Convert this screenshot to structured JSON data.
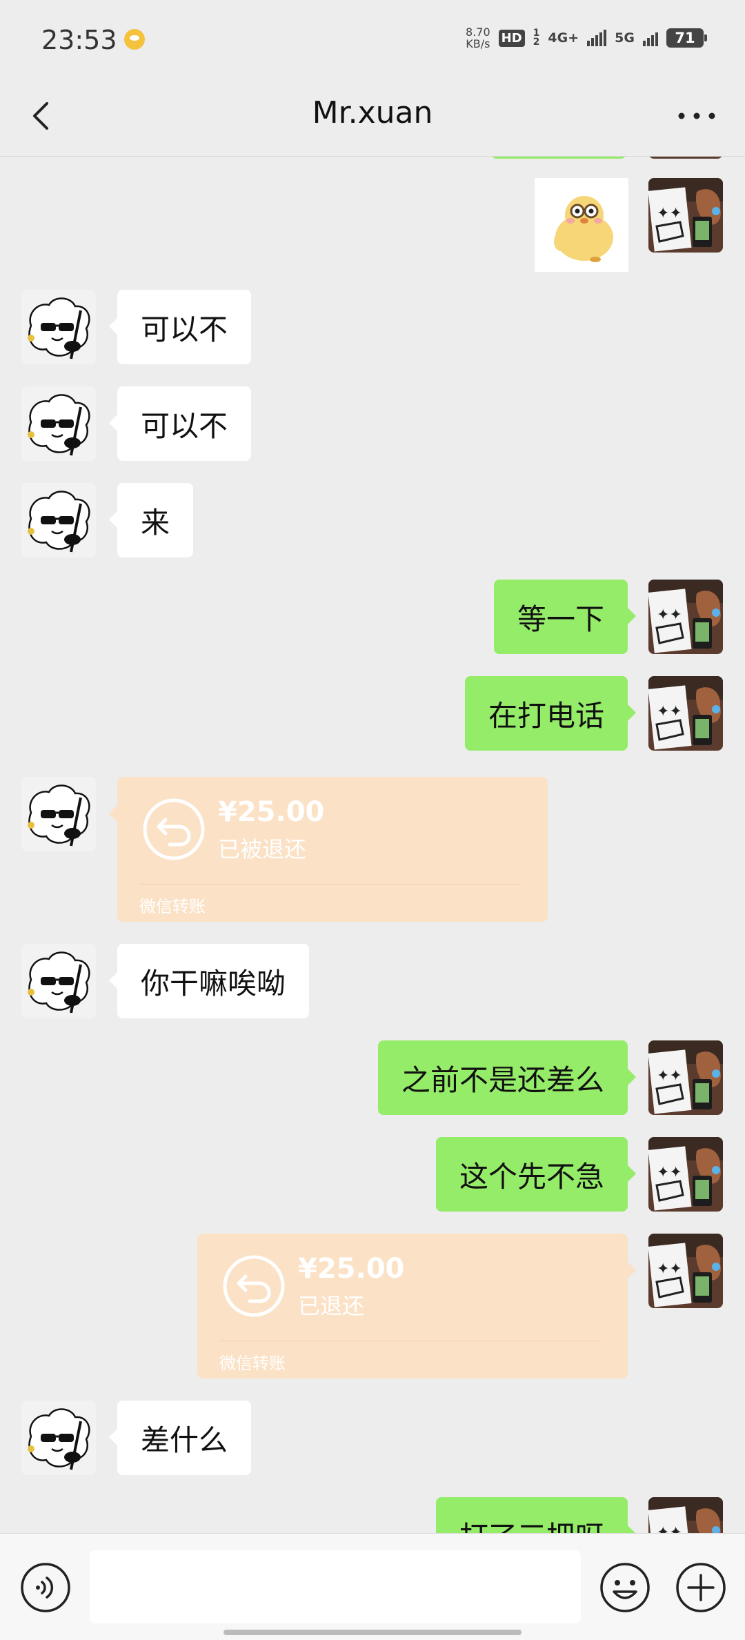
{
  "status_bar": {
    "time": "23:53",
    "net_speed_value": "8.70",
    "net_speed_unit": "KB/s",
    "hd_label": "HD",
    "sim_label": "1\n2",
    "net_4g": "4G+",
    "net_5g": "5G",
    "battery": "71"
  },
  "header": {
    "title": "Mr.xuan",
    "back_icon": "chevron-left-icon",
    "more_icon": "more-dots-icon"
  },
  "messages": [
    {
      "side": "right",
      "type": "sticker",
      "text": ""
    },
    {
      "side": "left",
      "type": "text",
      "text": "可以不"
    },
    {
      "side": "left",
      "type": "text",
      "text": "可以不"
    },
    {
      "side": "left",
      "type": "text",
      "text": "来"
    },
    {
      "side": "right",
      "type": "text",
      "text": "等一下"
    },
    {
      "side": "right",
      "type": "text",
      "text": "在打电话"
    },
    {
      "side": "left",
      "type": "transfer",
      "amount": "¥25.00",
      "status": "已被退还",
      "label": "微信转账"
    },
    {
      "side": "left",
      "type": "text",
      "text": "你干嘛唉呦"
    },
    {
      "side": "right",
      "type": "text",
      "text": "之前不是还差么"
    },
    {
      "side": "right",
      "type": "text",
      "text": "这个先不急"
    },
    {
      "side": "right",
      "type": "transfer",
      "amount": "¥25.00",
      "status": "已退还",
      "label": "微信转账"
    },
    {
      "side": "left",
      "type": "text",
      "text": "差什么"
    },
    {
      "side": "right",
      "type": "text",
      "text": "打了三把呀"
    }
  ],
  "colors": {
    "bubble_self": "#95ec69",
    "bubble_other": "#ffffff",
    "transfer": "#fbe1c5",
    "background": "#ededed"
  },
  "input_bar": {
    "placeholder": "",
    "voice_icon": "voice-icon",
    "emoji_icon": "emoji-icon",
    "plus_icon": "plus-icon"
  }
}
